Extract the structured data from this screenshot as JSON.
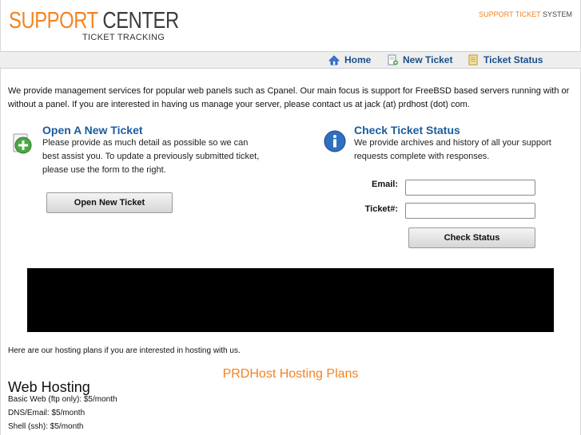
{
  "header": {
    "logo_word1": "SUPPORT",
    "logo_word2": "CENTER",
    "logo_sub": "TICKET TRACKING",
    "system_word1": "SUPPORT TICKET",
    "system_word2": "SYSTEM"
  },
  "nav": {
    "items": [
      {
        "label": "Home",
        "icon": "home-icon"
      },
      {
        "label": "New Ticket",
        "icon": "new-ticket-icon"
      },
      {
        "label": "Ticket Status",
        "icon": "ticket-status-icon"
      }
    ]
  },
  "intro": "We provide management services for popular web panels such as Cpanel. Our main focus is support for FreeBSD based servers running with or without a panel. If you are interested in having us manage your server, please contact us at jack (at) prdhost (dot) com.",
  "new_ticket": {
    "title": "Open A New Ticket",
    "text": "Please provide as much detail as possible so we can best assist you. To update a previously submitted ticket, please use the form to the right.",
    "button": "Open New Ticket",
    "icon": "add-icon"
  },
  "check_status": {
    "title": "Check Ticket Status",
    "text": "We provide archives and history of all your support requests complete with responses.",
    "email_label": "Email:",
    "email_value": "",
    "ticket_label": "Ticket#:",
    "ticket_value": "",
    "button": "Check Status",
    "icon": "info-icon"
  },
  "plans": {
    "intro": "Here are our hosting plans if you are interested in hosting with us.",
    "title": "PRDHost Hosting Plans",
    "section": "Web Hosting",
    "items": [
      "Basic Web (ftp only): $5/month",
      "DNS/Email: $5/month",
      "Shell (ssh): $5/month"
    ]
  },
  "colors": {
    "accent_orange": "#f5821f",
    "link_blue": "#1a4f8a",
    "title_blue": "#1a5c9e"
  }
}
